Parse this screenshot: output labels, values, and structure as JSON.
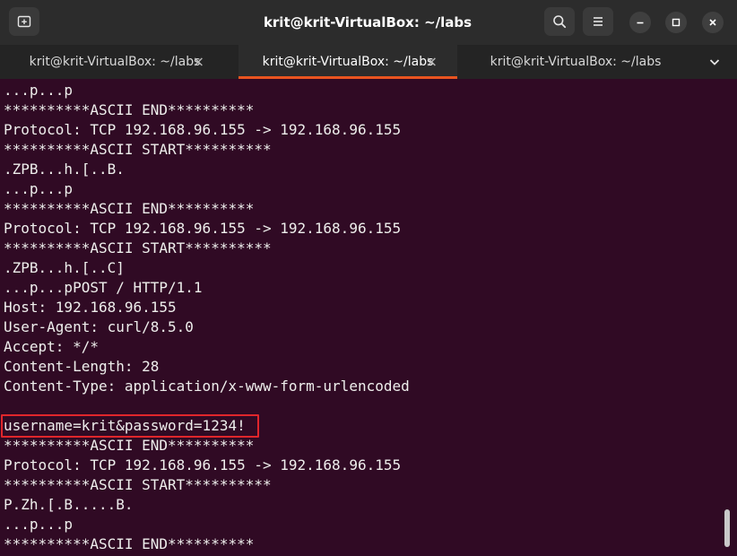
{
  "window": {
    "title": "krit@krit-VirtualBox: ~/labs"
  },
  "icons": {
    "new_tab": "new-tab-icon",
    "search": "search-icon",
    "menu": "hamburger-menu-icon",
    "minimize": "minimize-icon",
    "maximize": "maximize-icon",
    "close": "close-icon",
    "tab_list": "chevron-down-icon"
  },
  "tabs": [
    {
      "label": "krit@krit-VirtualBox: ~/labs",
      "close": "×",
      "active": false
    },
    {
      "label": "krit@krit-VirtualBox: ~/labs",
      "close": "×",
      "active": true
    },
    {
      "label": "krit@krit-VirtualBox: ~/labs",
      "close": "",
      "active": false
    }
  ],
  "terminal": {
    "lines": [
      "...p...p",
      "**********ASCII END**********",
      "Protocol: TCP 192.168.96.155 -> 192.168.96.155",
      "**********ASCII START**********",
      ".ZPB...h.[..B.",
      "...p...p",
      "**********ASCII END**********",
      "Protocol: TCP 192.168.96.155 -> 192.168.96.155",
      "**********ASCII START**********",
      ".ZPB...h.[..C]",
      "...p...pPOST / HTTP/1.1",
      "Host: 192.168.96.155",
      "User-Agent: curl/8.5.0",
      "Accept: */*",
      "Content-Length: 28",
      "Content-Type: application/x-www-form-urlencoded",
      "",
      "username=krit&password=1234!",
      "**********ASCII END**********",
      "Protocol: TCP 192.168.96.155 -> 192.168.96.155",
      "**********ASCII START**********",
      "P.Zh.[.B.....B.",
      "...p...p",
      "**********ASCII END**********"
    ]
  },
  "colors": {
    "terminal_bg": "#300a24",
    "terminal_fg": "#eeeeec",
    "highlight_border": "#e0262b",
    "active_tab_accent": "#e95420"
  }
}
